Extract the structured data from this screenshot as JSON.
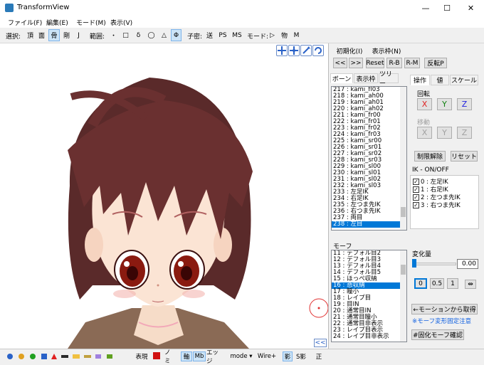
{
  "window": {
    "title": "TransformView",
    "min": "—",
    "max": "☐",
    "close": "✕"
  },
  "menu": [
    "ファイル(F)",
    "編集(E)",
    "モード(M)",
    "表示(V)"
  ],
  "toolbar": {
    "select_label": "選択:",
    "select_items": [
      "頂",
      "面",
      "骨",
      "剛",
      "J"
    ],
    "range_label": "範囲:",
    "range_items": [
      "・",
      "□",
      "δ",
      "◯",
      "△",
      "Φ"
    ],
    "child_label": "子密:",
    "child_items": [
      "送",
      "PS",
      "MS"
    ],
    "mode_label": "モード:",
    "mode_items": [
      "▷",
      "物",
      "M"
    ]
  },
  "viewport": {
    "buttons": [
      "move-icon",
      "move-all-icon",
      "rotate-icon",
      "rotate-all-icon"
    ],
    "collapse": "<<"
  },
  "right": {
    "row1": [
      "初期化(I)",
      "表示枠(N)"
    ],
    "row2": [
      "<<",
      ">>",
      "Reset",
      "R-B",
      "R-M",
      "反転P"
    ],
    "tabs_left": [
      "ボーン",
      "表示枠",
      "ツリー"
    ],
    "bones": [
      "217 : kami_fl03",
      "218 : kami_ah00",
      "219 : kami_ah01",
      "220 : kami_ah02",
      "221 : kami_fr00",
      "222 : kami_fr01",
      "223 : kami_fr02",
      "224 : kami_fr03",
      "225 : kami_sr00",
      "226 : kami_sr01",
      "227 : kami_sr02",
      "228 : kami_sr03",
      "229 : kami_sl00",
      "230 : kami_sl01",
      "231 : kami_sl02",
      "232 : kami_sl03",
      "233 : 左足IK",
      "234 : 右足IK",
      "235 : 左つま先IK",
      "236 : 右つま先IK",
      "237 : 両目",
      "238 : 左目"
    ],
    "tabs_right": [
      "操作",
      "値",
      "スケール"
    ],
    "rotate_label": "回転",
    "rot": [
      "X",
      "Y",
      "Z"
    ],
    "move_label": "移動",
    "mov": [
      "X",
      "Y",
      "Z"
    ],
    "unlimit": "制限解除",
    "reset": "リセット",
    "ik_label": "IK - ON/OFF",
    "ik_items": [
      "0 : 左足IK",
      "1 : 右足IK",
      "2 : 左つま先IK",
      "3 : 右つま先IK"
    ],
    "morph_label": "モーフ",
    "morphs": [
      "11 : デフォル目2",
      "12 : デフォル目3",
      "13 : デフォル目4",
      "14 : デフォル目5",
      "15 : ほっぺ収納",
      "16 : 悲収納",
      "17 : 瞳小",
      "18 : レイプ目",
      "19 : 目IN",
      "20 : 通常目IN",
      "21 : 通常目瞳小",
      "22 : 通常目非表示",
      "23 : レイプ目表示",
      "24 : レイプ目非表示"
    ],
    "change_label": "変化量",
    "change_value": "0.00",
    "slider_level": 0.0,
    "step_buttons": [
      "0",
      "0.5",
      "1"
    ],
    "step_extra": "⇹",
    "from_motion": "←モーションから取得",
    "fixed_note": "※モーフ変形固定注意",
    "confirm": "#固化モーフ確認"
  },
  "status": {
    "items": [
      "表現",
      "ノミ",
      "軸",
      "Mb",
      "エッジ",
      "mode ▾",
      "Wire+",
      "影",
      "S影",
      "正"
    ]
  }
}
